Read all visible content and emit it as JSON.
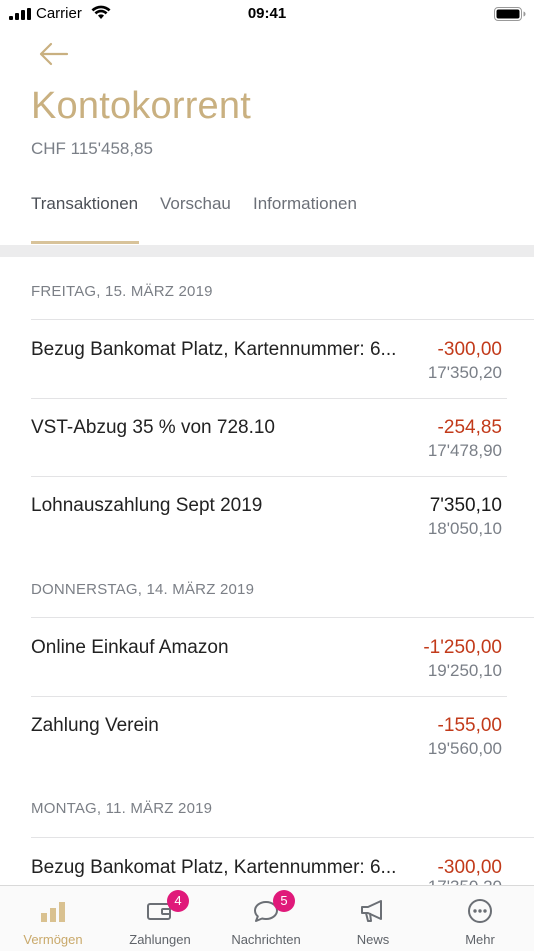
{
  "status_bar": {
    "carrier": "Carrier",
    "time": "09:41"
  },
  "header": {
    "title": "Kontokorrent",
    "balance": "CHF 115'458,85"
  },
  "tabs": [
    {
      "label": "Transaktionen",
      "active": true
    },
    {
      "label": "Vorschau",
      "active": false
    },
    {
      "label": "Informationen",
      "active": false
    }
  ],
  "sections": [
    {
      "date": "FREITAG, 15. MÄRZ 2019",
      "transactions": [
        {
          "description": "Bezug Bankomat Platz, Kartennummer: 6...",
          "amount": "-300,00",
          "balance": "17'350,20",
          "negative": true
        },
        {
          "description": "VST-Abzug 35 % von 728.10",
          "amount": "-254,85",
          "balance": "17'478,90",
          "negative": true
        },
        {
          "description": "Lohnauszahlung Sept 2019",
          "amount": "7'350,10",
          "balance": "18'050,10",
          "negative": false
        }
      ]
    },
    {
      "date": "DONNERSTAG, 14. MÄRZ 2019",
      "transactions": [
        {
          "description": "Online Einkauf Amazon",
          "amount": "-1'250,00",
          "balance": "19'250,10",
          "negative": true
        },
        {
          "description": "Zahlung Verein",
          "amount": "-155,00",
          "balance": "19'560,00",
          "negative": true
        }
      ]
    },
    {
      "date": "MONTAG, 11. MÄRZ 2019",
      "transactions": [
        {
          "description": "Bezug Bankomat Platz, Kartennummer: 6...",
          "amount": "-300,00",
          "balance": "17'350,20",
          "negative": true
        }
      ]
    }
  ],
  "tab_bar": [
    {
      "label": "Vermögen",
      "icon": "bar-chart-icon",
      "active": true,
      "badge": null
    },
    {
      "label": "Zahlungen",
      "icon": "wallet-icon",
      "active": false,
      "badge": "4"
    },
    {
      "label": "Nachrichten",
      "icon": "chat-bubble-icon",
      "active": false,
      "badge": "5"
    },
    {
      "label": "News",
      "icon": "megaphone-icon",
      "active": false,
      "badge": null
    },
    {
      "label": "Mehr",
      "icon": "more-icon",
      "active": false,
      "badge": null
    }
  ],
  "colors": {
    "accent": "#c9b080",
    "negative": "#c23a1a",
    "badge": "#e0197a",
    "muted": "#7a7f87"
  }
}
